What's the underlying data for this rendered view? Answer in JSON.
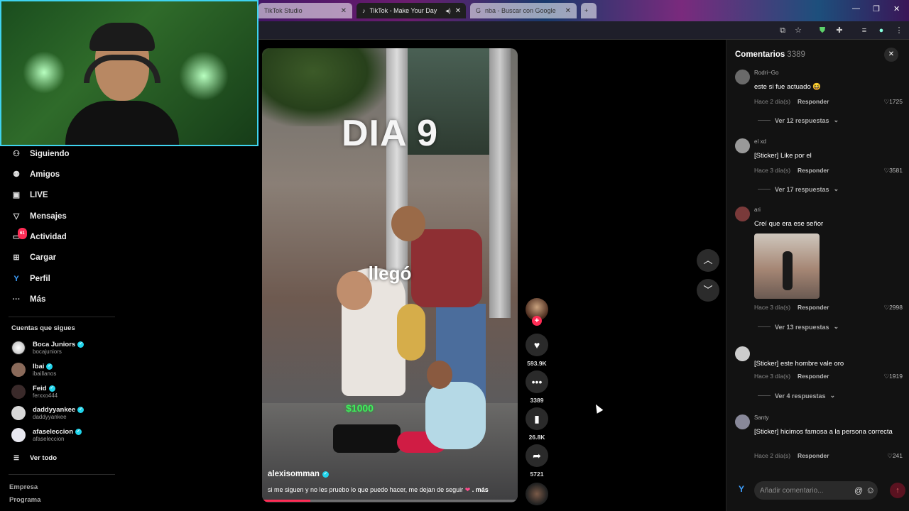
{
  "browser": {
    "tabs": [
      {
        "label": "TikTok Studio"
      },
      {
        "label": "TikTok - Make Your Day"
      },
      {
        "label": "nba - Buscar con Google"
      }
    ]
  },
  "sidebar": {
    "items": [
      {
        "label": "Siguiendo",
        "icon": "following-icon"
      },
      {
        "label": "Amigos",
        "icon": "friends-icon"
      },
      {
        "label": "LIVE",
        "icon": "live-icon"
      },
      {
        "label": "Mensajes",
        "icon": "messages-icon"
      },
      {
        "label": "Actividad",
        "icon": "activity-icon",
        "badge": "61"
      },
      {
        "label": "Cargar",
        "icon": "upload-icon"
      },
      {
        "label": "Perfil",
        "icon": "profile-icon"
      },
      {
        "label": "Más",
        "icon": "more-icon"
      }
    ],
    "following_title": "Cuentas que sigues",
    "accounts": [
      {
        "name": "Boca Juniors",
        "username": "bocajuniors"
      },
      {
        "name": "Ibai",
        "username": "ibaillanos"
      },
      {
        "name": "Feid",
        "username": "ferxxo444"
      },
      {
        "name": "daddyyankee",
        "username": "daddyyankee"
      },
      {
        "name": "afaseleccion",
        "username": "afaseleccion"
      }
    ],
    "see_all": "Ver todo",
    "footer": [
      "Empresa",
      "Programa"
    ]
  },
  "video": {
    "overlay_title": "DIA 9",
    "overlay_mid": "llegó",
    "overlay_money": "$1000",
    "author": "alexisomman",
    "caption": "si me siguen y no les pruebo lo que puedo hacer, me dejan de seguir",
    "caption_more": ". más",
    "progress": 0.19
  },
  "actions": {
    "likes": "593.9K",
    "comments": "3389",
    "saves": "26.8K",
    "shares": "5721"
  },
  "comments_panel": {
    "title": "Comentarios",
    "count": "3389",
    "input_placeholder": "Añadir comentario...",
    "items": [
      {
        "user": "Rodri~Go",
        "text": "este si fue actuado 😆",
        "time": "Hace 2 día(s)",
        "reply": "Responder",
        "likes": "1725",
        "more": "Ver 12 respuestas"
      },
      {
        "user": "el xd",
        "text": "[Sticker] Like por el",
        "time": "Hace 3 día(s)",
        "reply": "Responder",
        "likes": "3581",
        "more": "Ver 17 respuestas"
      },
      {
        "user": "ari",
        "text": "Creí que era ese señor",
        "time": "Hace 3 día(s)",
        "reply": "Responder",
        "likes": "2998",
        "more": "Ver 13 respuestas"
      },
      {
        "user": "",
        "text": "[Sticker] este hombre vale oro",
        "time": "Hace 3 día(s)",
        "reply": "Responder",
        "likes": "1919",
        "more": "Ver 4 respuestas"
      },
      {
        "user": "Santy",
        "text": "[Sticker] hicimos famosa a la persona correcta",
        "time": "Hace 2 día(s)",
        "reply": "Responder",
        "likes": "241",
        "more": ""
      }
    ]
  },
  "colors": {
    "accent": "#fe2c55",
    "verified": "#20d5ec",
    "webcam_border": "#3fd3f0"
  }
}
